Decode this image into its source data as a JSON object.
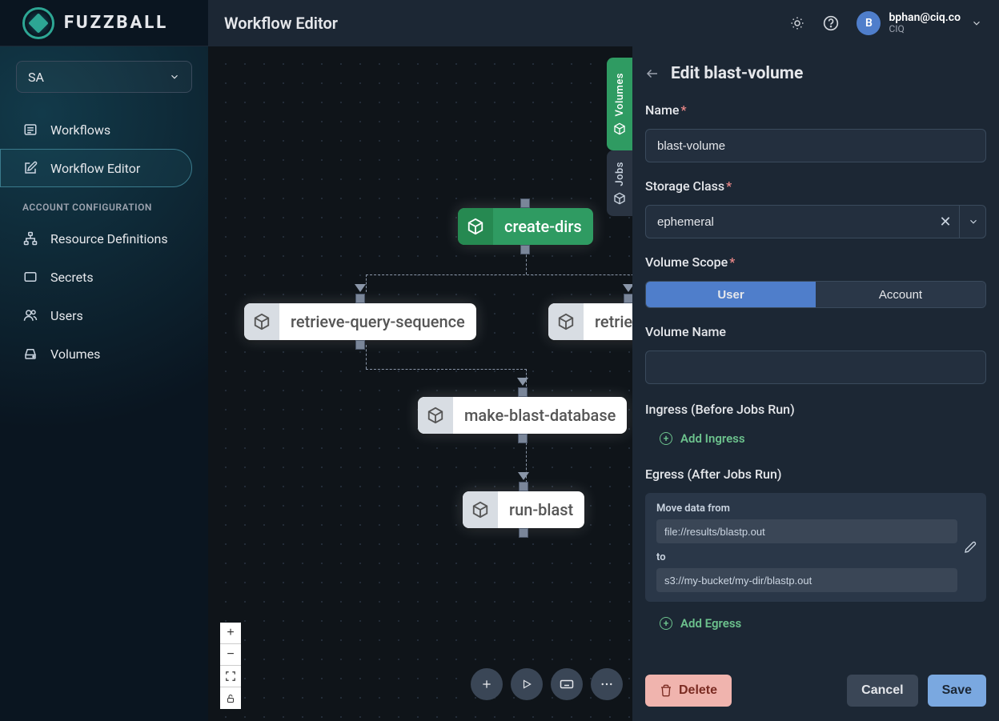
{
  "brand": "FUZZBALL",
  "page_title": "Workflow Editor",
  "user": {
    "initial": "B",
    "email": "bphan@ciq.co",
    "org": "CIQ"
  },
  "sidebar": {
    "org": "SA",
    "items": [
      {
        "label": "Workflows"
      },
      {
        "label": "Workflow Editor"
      }
    ],
    "section_label": "ACCOUNT CONFIGURATION",
    "config_items": [
      {
        "label": "Resource Definitions"
      },
      {
        "label": "Secrets"
      },
      {
        "label": "Users"
      },
      {
        "label": "Volumes"
      }
    ]
  },
  "canvas": {
    "tabs": {
      "volumes": "Volumes",
      "jobs": "Jobs"
    },
    "nodes": {
      "create_dirs": "create-dirs",
      "retrieve_query": "retrieve-query-sequence",
      "retrieve_partial": "retrie",
      "make_blast_db": "make-blast-database",
      "run_blast": "run-blast"
    }
  },
  "panel": {
    "title": "Edit blast-volume",
    "name_label": "Name",
    "name_value": "blast-volume",
    "storage_label": "Storage Class",
    "storage_value": "ephemeral",
    "scope_label": "Volume Scope",
    "scope_options": {
      "user": "User",
      "account": "Account"
    },
    "volname_label": "Volume Name",
    "volname_value": "",
    "ingress_label": "Ingress (Before Jobs Run)",
    "add_ingress": "Add Ingress",
    "egress_label": "Egress (After Jobs Run)",
    "egress": {
      "from_label": "Move data from",
      "from_value": "file://results/blastp.out",
      "to_label": "to",
      "to_value": "s3://my-bucket/my-dir/blastp.out"
    },
    "add_egress": "Add Egress",
    "delete": "Delete",
    "cancel": "Cancel",
    "save": "Save"
  }
}
